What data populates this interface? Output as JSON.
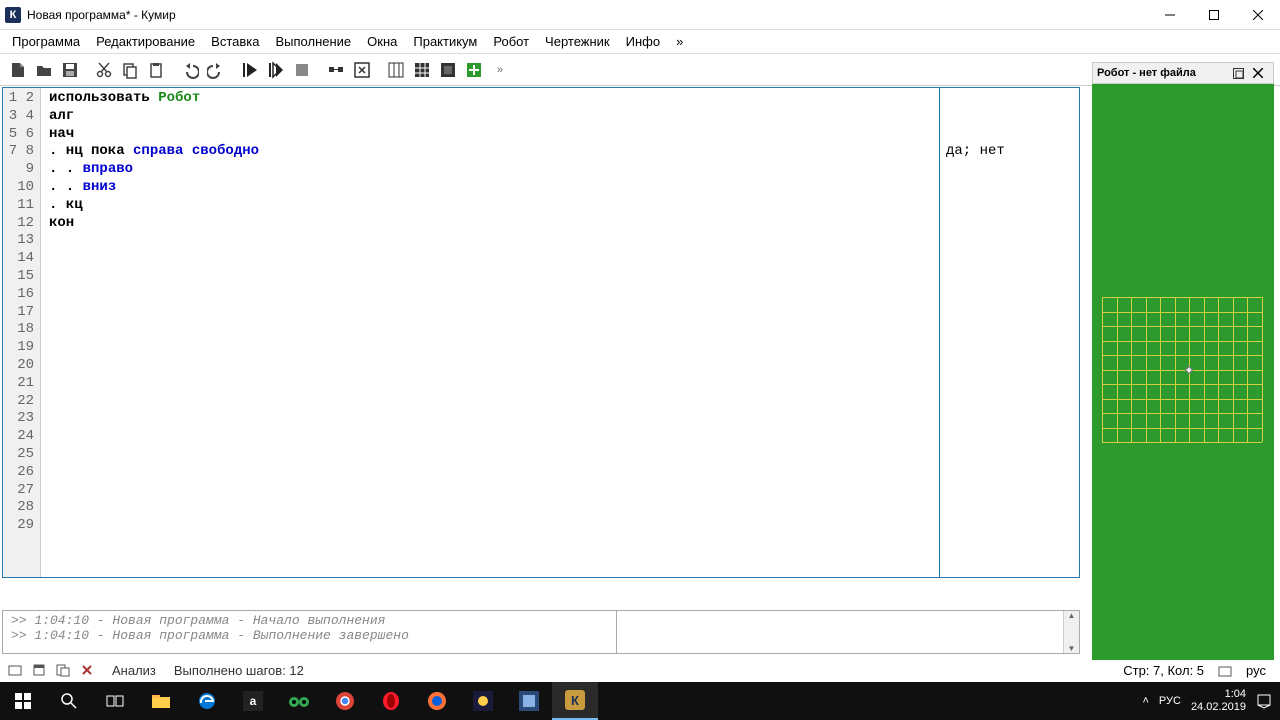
{
  "window": {
    "title": "Новая программа* - Кумир",
    "app_icon_letter": "К"
  },
  "menu": [
    "Программа",
    "Редактирование",
    "Вставка",
    "Выполнение",
    "Окна",
    "Практикум",
    "Робот",
    "Чертежник",
    "Инфо",
    "»"
  ],
  "code": {
    "lines": [
      {
        "n": 1,
        "segments": [
          {
            "t": "использовать ",
            "c": "plain"
          },
          {
            "t": "Робот",
            "c": "actor"
          }
        ]
      },
      {
        "n": 2,
        "segments": [
          {
            "t": "алг",
            "c": "plain"
          }
        ]
      },
      {
        "n": 3,
        "segments": [
          {
            "t": "нач",
            "c": "plain"
          }
        ]
      },
      {
        "n": 4,
        "segments": [
          {
            "t": ". нц пока ",
            "c": "plain"
          },
          {
            "t": "справа свободно",
            "c": "cmd"
          }
        ]
      },
      {
        "n": 5,
        "segments": [
          {
            "t": ". . ",
            "c": "plain"
          },
          {
            "t": "вправо",
            "c": "cmd"
          }
        ]
      },
      {
        "n": 6,
        "segments": [
          {
            "t": ". . ",
            "c": "plain"
          },
          {
            "t": "вниз",
            "c": "cmd"
          }
        ]
      },
      {
        "n": 7,
        "segments": [
          {
            "t": ". кц",
            "c": "plain"
          }
        ]
      },
      {
        "n": 8,
        "segments": [
          {
            "t": "кон",
            "c": "plain"
          }
        ]
      }
    ],
    "total_gutter_lines": 29,
    "side_text": "\n\n\nда; нет"
  },
  "console": {
    "lines": [
      ">>  1:04:10 - Новая программа - Начало выполнения",
      ">>  1:04:10 - Новая программа - Выполнение завершено"
    ]
  },
  "status": {
    "analysis": "Анализ",
    "steps": "Выполнено шагов: 12",
    "cursor": "Стр: 7, Кол: 5",
    "lang": "рус"
  },
  "robot_panel": {
    "title": "Робот - нет файла"
  },
  "taskbar": {
    "tray_lang": "РУС",
    "time": "1:04",
    "date": "24.02.2019"
  }
}
